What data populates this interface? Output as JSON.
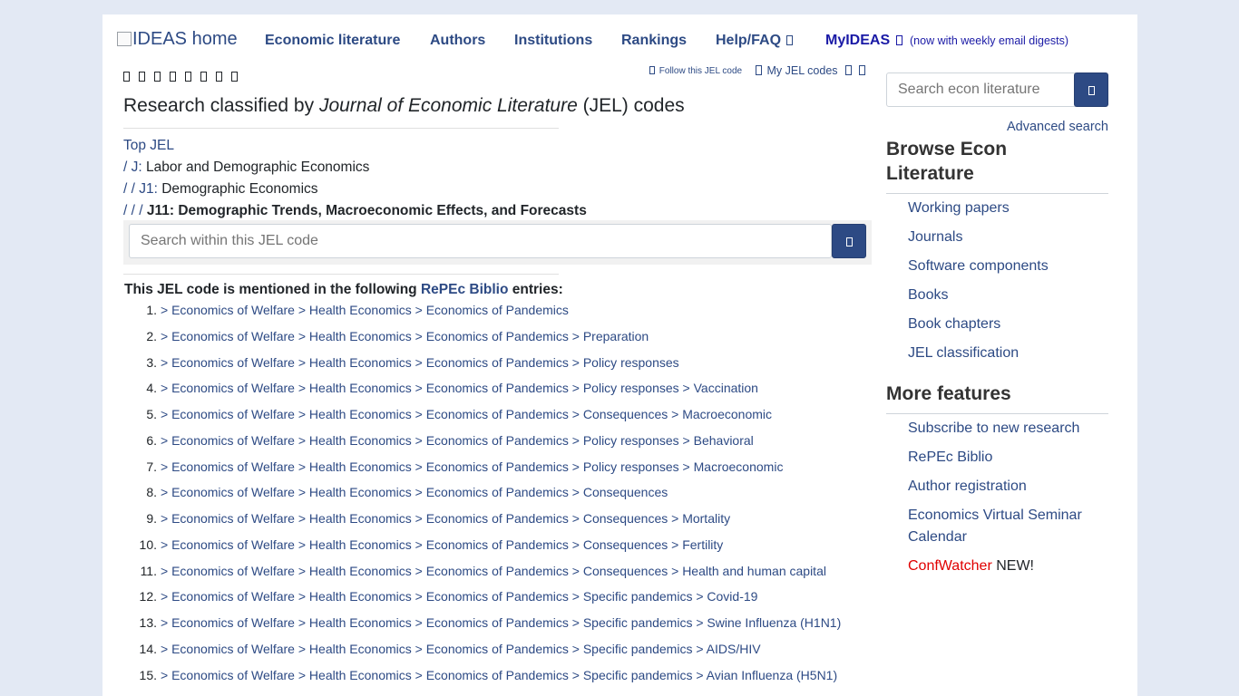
{
  "header": {
    "logo_alt": "IDEAS home",
    "nav": [
      {
        "label": "Economic literature"
      },
      {
        "label": "Authors"
      },
      {
        "label": "Institutions"
      },
      {
        "label": "Rankings"
      },
      {
        "label": "Help/FAQ"
      }
    ],
    "myideas_label": "MyIDEAS",
    "myideas_note": "(now with weekly email digests)",
    "follow_jel": "Follow this JEL code",
    "my_jel_codes": "My JEL codes"
  },
  "main": {
    "title_pre": "Research classified by ",
    "title_em": "Journal of Economic Literature",
    "title_post": " (JEL) codes",
    "breadcrumb": {
      "top": "Top JEL",
      "l1_prefix": "/ ",
      "l1_code": "J:",
      "l1_name": " Labor and Demographic Economics",
      "l2_prefix": "/ / ",
      "l2_code": "J1:",
      "l2_name": " Demographic Economics",
      "l3_prefix": "/ / / ",
      "l3_current": "J11: Demographic Trends, Macroeconomic Effects, and Forecasts"
    },
    "jel_search_placeholder": "Search within this JEL code",
    "mention_pre": "This JEL code is mentioned in the following ",
    "mention_link": "RePEc Biblio",
    "mention_post": " entries:",
    "entries": [
      {
        "num": "1.",
        "path": "> Economics of Welfare > Health Economics > Economics of Pandemics"
      },
      {
        "num": "2.",
        "path": "> Economics of Welfare > Health Economics > Economics of Pandemics > Preparation"
      },
      {
        "num": "3.",
        "path": "> Economics of Welfare > Health Economics > Economics of Pandemics > Policy responses"
      },
      {
        "num": "4.",
        "path": "> Economics of Welfare > Health Economics > Economics of Pandemics > Policy responses > Vaccination"
      },
      {
        "num": "5.",
        "path": "> Economics of Welfare > Health Economics > Economics of Pandemics > Consequences > Macroeconomic"
      },
      {
        "num": "6.",
        "path": "> Economics of Welfare > Health Economics > Economics of Pandemics > Policy responses > Behavioral"
      },
      {
        "num": "7.",
        "path": "> Economics of Welfare > Health Economics > Economics of Pandemics > Policy responses > Macroeconomic"
      },
      {
        "num": "8.",
        "path": "> Economics of Welfare > Health Economics > Economics of Pandemics > Consequences"
      },
      {
        "num": "9.",
        "path": "> Economics of Welfare > Health Economics > Economics of Pandemics > Consequences > Mortality"
      },
      {
        "num": "10.",
        "path": "> Economics of Welfare > Health Economics > Economics of Pandemics > Consequences > Fertility"
      },
      {
        "num": "11.",
        "path": "> Economics of Welfare > Health Economics > Economics of Pandemics > Consequences > Health and human capital"
      },
      {
        "num": "12.",
        "path": "> Economics of Welfare > Health Economics > Economics of Pandemics > Specific pandemics > Covid-19"
      },
      {
        "num": "13.",
        "path": "> Economics of Welfare > Health Economics > Economics of Pandemics > Specific pandemics > Swine Influenza (H1N1)"
      },
      {
        "num": "14.",
        "path": "> Economics of Welfare > Health Economics > Economics of Pandemics > Specific pandemics > AIDS/HIV"
      },
      {
        "num": "15.",
        "path": "> Economics of Welfare > Health Economics > Economics of Pandemics > Specific pandemics > Avian Influenza (H5N1)"
      }
    ]
  },
  "sidebar": {
    "search_placeholder": "Search econ literature",
    "advanced_search": "Advanced search",
    "browse_title": "Browse Econ Literature",
    "browse_items": [
      "Working papers",
      "Journals",
      "Software components",
      "Books",
      "Book chapters",
      "JEL classification"
    ],
    "features_title": "More features",
    "features_items": [
      "Subscribe to new research",
      "RePEc Biblio",
      "Author registration",
      "Economics Virtual Seminar Calendar"
    ],
    "confwatcher": "ConfWatcher",
    "confwatcher_new": " NEW!"
  },
  "colors": {
    "link": "#2d4a84",
    "myideas": "#1a1aa6",
    "button": "#2d4a84",
    "confwatcher": "#e00000",
    "page_bg": "#e3e9f4"
  }
}
